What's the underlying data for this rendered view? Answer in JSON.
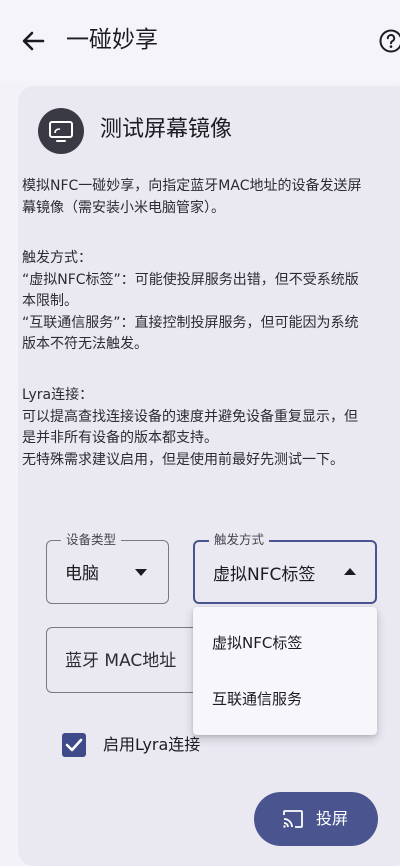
{
  "appbar": {
    "title": "一碰妙享"
  },
  "card": {
    "title": "测试屏幕镜像",
    "paragraphs": [
      "模拟NFC一碰妙享，向指定蓝牙MAC地址的设备发送屏幕镜像（需安装小米电脑管家）。",
      "触发方式：",
      "“虚拟NFC标签”：可能使投屏服务出错，但不受系统版本限制。",
      "“互联通信服务”：直接控制投屏服务，但可能因为系统版本不符无法触发。",
      "Lyra连接：",
      "可以提高查找连接设备的速度并避免设备重复显示，但是并非所有设备的版本都支持。",
      "无特殊需求建议启用，但是使用前最好先测试一下。"
    ]
  },
  "device_type": {
    "label": "设备类型",
    "value": "电脑"
  },
  "trigger_mode": {
    "label": "触发方式",
    "value": "虚拟NFC标签"
  },
  "mac_input": {
    "placeholder": "蓝牙 MAC地址"
  },
  "dropdown": {
    "options": [
      "虚拟NFC标签",
      "互联通信服务"
    ]
  },
  "lyra": {
    "label": "启用Lyra连接",
    "checked": true
  },
  "cast_button": {
    "label": "投屏"
  },
  "colors": {
    "accent": "#4a5590",
    "checkbox": "#3f4a8a",
    "card": "#eae8f1",
    "background": "#f3f2f8"
  }
}
